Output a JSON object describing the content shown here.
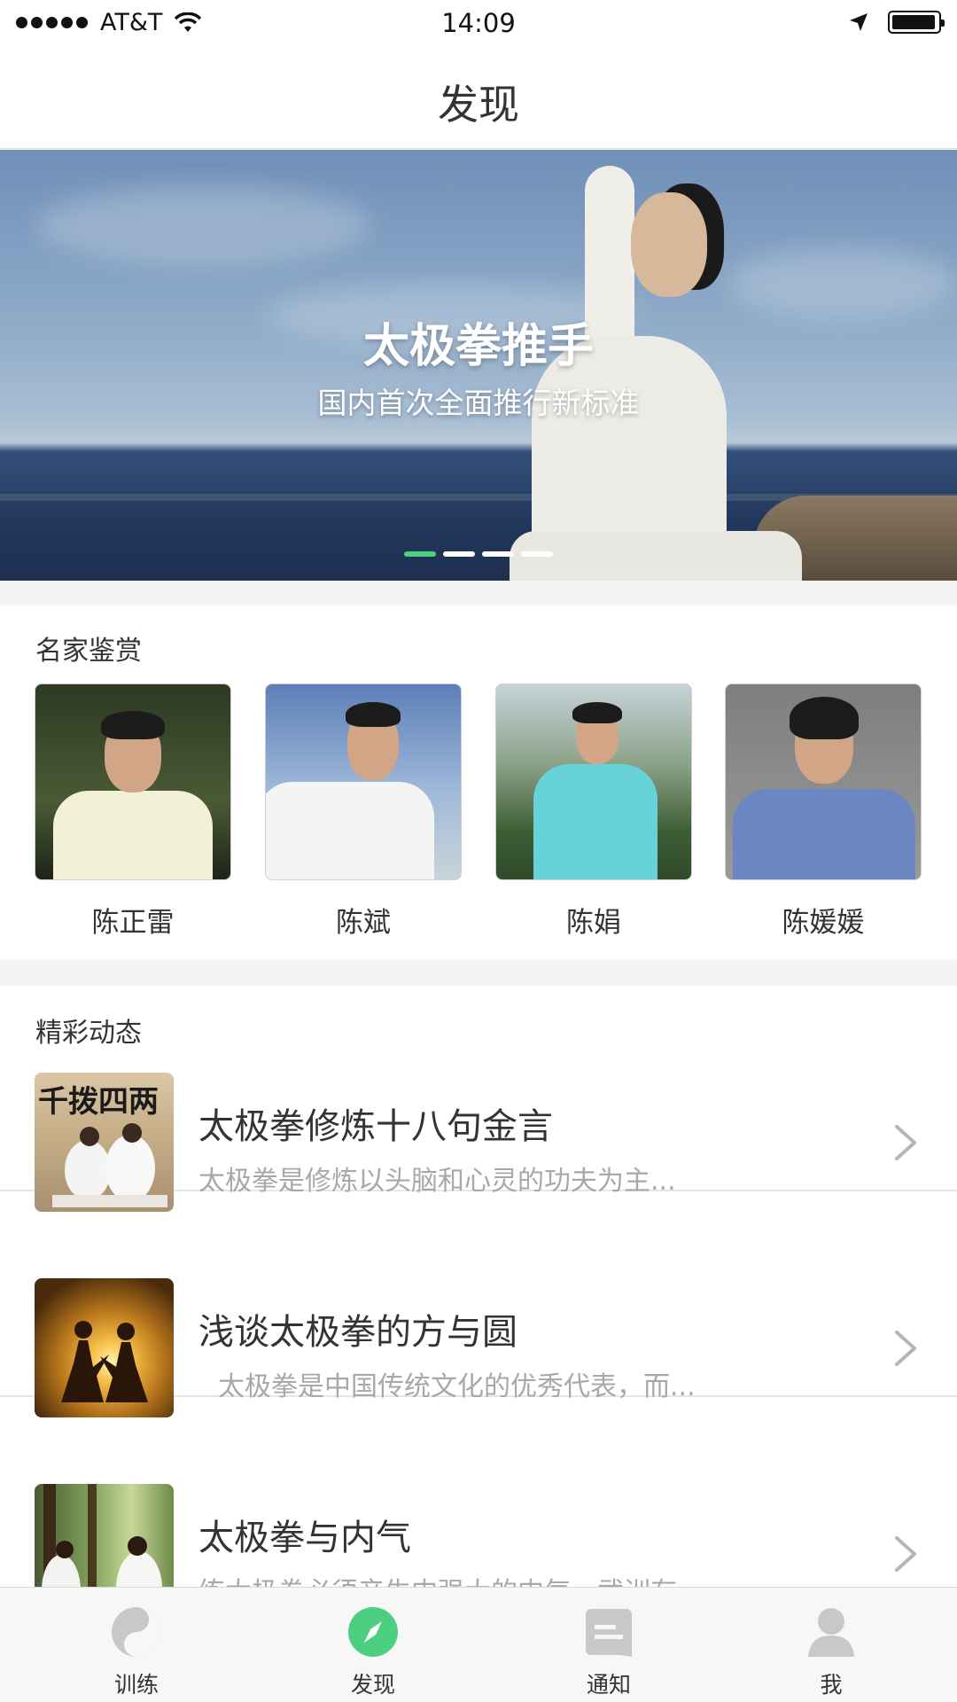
{
  "status_bar": {
    "carrier": "AT&T",
    "time": "14:09",
    "battery_level": 0.95
  },
  "nav": {
    "title": "发现"
  },
  "banner": {
    "title": "太极拳推手",
    "subtitle": "国内首次全面推行新标准",
    "pages": 4,
    "active_page": 0
  },
  "masters": {
    "title": "名家鉴赏",
    "items": [
      {
        "name": "陈正雷"
      },
      {
        "name": "陈斌"
      },
      {
        "name": "陈娟"
      },
      {
        "name": "陈媛媛"
      }
    ]
  },
  "feeds": {
    "title": "精彩动态",
    "items": [
      {
        "title": "太极拳修炼十八句金言",
        "desc": "太极拳是修炼以头脑和心灵的功夫为主...",
        "thumb_text": "千拨四两"
      },
      {
        "title": "浅谈太极拳的方与圆",
        "desc": "太极拳是中国传统文化的优秀代表，而..."
      },
      {
        "title": "太极拳与内气",
        "desc": "练太极拳必须产生内强大的内气，武训有..."
      }
    ]
  },
  "tab_bar": {
    "items": [
      {
        "label": "训练",
        "icon": "taiji-icon",
        "active": false
      },
      {
        "label": "发现",
        "icon": "compass-icon",
        "active": true
      },
      {
        "label": "通知",
        "icon": "message-icon",
        "active": false
      },
      {
        "label": "我",
        "icon": "person-icon",
        "active": false
      }
    ],
    "active_color": "#4cd080",
    "inactive_color": "#c8c8c8"
  }
}
